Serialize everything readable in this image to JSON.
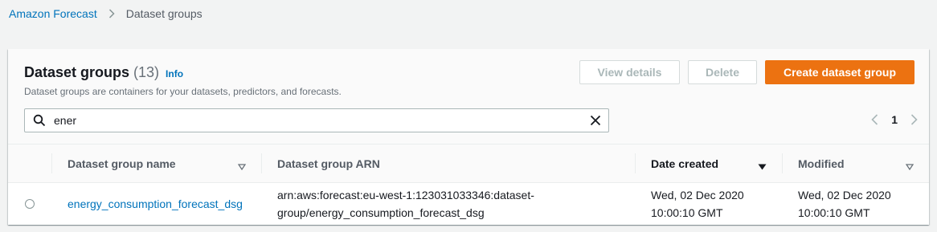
{
  "breadcrumb": {
    "root": "Amazon Forecast",
    "current": "Dataset groups"
  },
  "panel": {
    "title": "Dataset groups",
    "count": "(13)",
    "info": "Info",
    "description": "Dataset groups are containers for your datasets, predictors, and forecasts."
  },
  "actions": {
    "view_details": "View details",
    "delete": "Delete",
    "create": "Create dataset group"
  },
  "search": {
    "value": "ener",
    "placeholder": ""
  },
  "pagination": {
    "current_page": "1"
  },
  "table": {
    "columns": [
      "Dataset group name",
      "Dataset group ARN",
      "Date created",
      "Modified"
    ],
    "rows": [
      {
        "name": "energy_consumption_forecast_dsg",
        "arn_line1": "arn:aws:forecast:eu-west-1:123031033346:dataset-",
        "arn_line2": "group/energy_consumption_forecast_dsg",
        "created_line1": "Wed, 02 Dec 2020",
        "created_line2": "10:00:10 GMT",
        "modified_line1": "Wed, 02 Dec 2020",
        "modified_line2": "10:00:10 GMT"
      }
    ]
  },
  "colors": {
    "link": "#0073bb",
    "primary": "#ec7211",
    "background": "#f2f3f3"
  },
  "icons": {
    "breadcrumb_separator": "chevron-right-icon",
    "search": "search-icon",
    "clear": "close-icon",
    "prev": "chevron-left-icon",
    "next": "chevron-right-icon",
    "sort": "caret-down-icon"
  }
}
